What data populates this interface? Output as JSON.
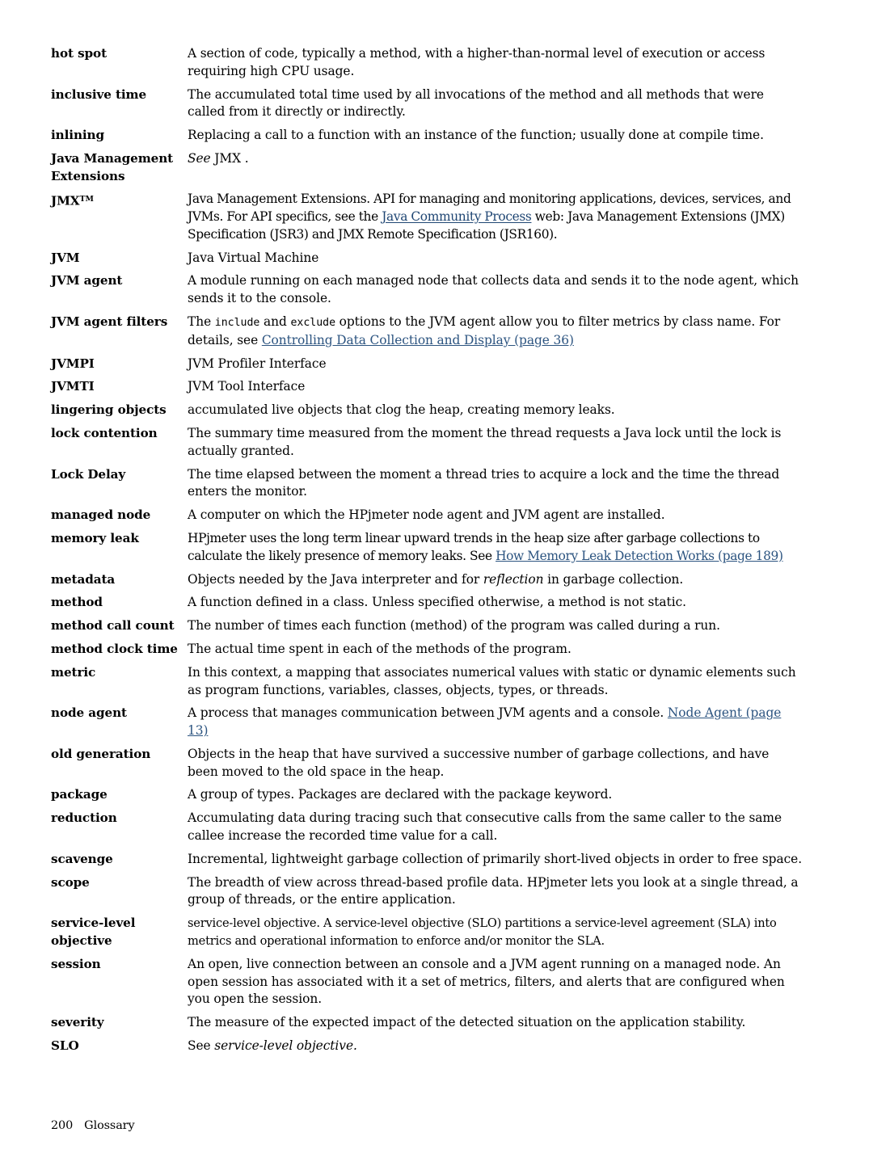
{
  "document": {
    "section": "Glossary",
    "page_number": "200"
  },
  "footer": {
    "page_number": "200",
    "label": "Glossary"
  },
  "entries": [
    {
      "term": "hot spot",
      "definition": "A section of code, typically a method, with a higher-than-normal level of execution or access requiring high CPU usage."
    },
    {
      "term": "inclusive time",
      "definition": "The accumulated total time used by all invocations of the method and all methods that were called from it directly or indirectly."
    },
    {
      "term": "inlining",
      "definition": "Replacing a call to a function with an instance of the function; usually done at compile time."
    },
    {
      "term": "Java Management Extensions",
      "definition_see": "See",
      "definition_target": "JMX",
      "definition_tail": "."
    },
    {
      "term": "JMX",
      "term_superscript": "TM",
      "def_part1": "Java Management Extensions. API for managing and monitoring applications, devices, services, and JVMs. For API specifics, see the ",
      "link_web": "Java Community Process",
      "def_part2": " web: Java Management Extensions (JMX) Specification (JSR3) and JMX Remote Specification (JSR160)."
    },
    {
      "term": "JVM",
      "definition": "Java Virtual Machine"
    },
    {
      "term": "JVM agent",
      "definition": "A module running on each managed node that collects data and sends it to the node agent, which sends it to the console."
    },
    {
      "term": "JVM agent filters",
      "def_a": "The ",
      "code_include": "include",
      "def_b": " and ",
      "code_exclude": "exclude",
      "def_c": " options to the JVM agent allow you to filter metrics by class name. For details, see ",
      "link_xref": "Controlling Data Collection and Display (page 36)"
    },
    {
      "term": "JVMPI",
      "definition": "JVM Profiler Interface"
    },
    {
      "term": "JVMTI",
      "definition": "JVM Tool Interface"
    },
    {
      "term": "lingering objects",
      "definition": "accumulated live objects that clog the heap, creating memory leaks."
    },
    {
      "term": "lock contention",
      "definition": "The summary time measured from the moment the thread requests a Java lock until the lock is actually granted."
    },
    {
      "term": "Lock Delay",
      "definition": "The time elapsed between the moment a thread tries to acquire a lock and the time the thread enters the monitor."
    },
    {
      "term": "managed node",
      "definition": "A computer on which the HPjmeter node agent and JVM agent are installed."
    },
    {
      "term": "memory leak",
      "def_a": "HPjmeter uses the long term linear upward trends in the heap size after garbage collections to calculate the likely presence of memory leaks. See ",
      "link_xref": "How Memory Leak Detection Works (page 189)"
    },
    {
      "term": "metadata",
      "def_a": "Objects needed by the Java interpreter and for ",
      "italic": "reflection",
      "def_b": " in garbage collection."
    },
    {
      "term": "method",
      "definition": "A function defined in a class. Unless specified otherwise, a method is not static."
    },
    {
      "term": "method call count",
      "definition": "The number of times each function (method) of the program was called during a run."
    },
    {
      "term": "method clock time",
      "definition": "The actual time spent in each of the methods of the program."
    },
    {
      "term": "metric",
      "definition": "In this context, a mapping that associates numerical values with static or dynamic elements such as program functions, variables, classes, objects, types, or threads."
    },
    {
      "term": "node agent",
      "def_a": "A process that manages communication between JVM agents and a console. ",
      "link_xref": "Node Agent (page 13)"
    },
    {
      "term": "old generation",
      "definition": "Objects in the heap that have survived a successive number of garbage collections, and have been moved to the old space in the heap."
    },
    {
      "term": "package",
      "definition": "A group of types. Packages are declared with the package keyword."
    },
    {
      "term": "reduction",
      "definition": "Accumulating data during tracing such that consecutive calls from the same caller to the same callee increase the recorded time value for a call."
    },
    {
      "term": "scavenge",
      "definition": "Incremental, lightweight garbage collection of primarily short-lived objects in order to free space."
    },
    {
      "term": "scope",
      "definition": "The breadth of view across thread-based profile data. HPjmeter lets you look at a single thread, a group of threads, or the entire application."
    },
    {
      "term": "service-level objective",
      "definition": "service-level objective. A service-level objective (SLO) partitions a service-level agreement (SLA) into metrics and operational information to enforce and/or monitor the SLA."
    },
    {
      "term": "session",
      "definition": "An open, live connection between an console and a JVM agent running on a managed node. An open session has associated with it a set of metrics, filters, and alerts that are configured when you open the session."
    },
    {
      "term": "severity",
      "definition": "The measure of the expected impact of the detected situation on the application stability."
    },
    {
      "term": "SLO",
      "def_see": "See ",
      "italic": "service-level objective."
    }
  ],
  "colors": {
    "text": "#000000",
    "cross_reference_link": "#2c5480",
    "web_link": "#1f4673",
    "page_background": "#ffffff"
  }
}
